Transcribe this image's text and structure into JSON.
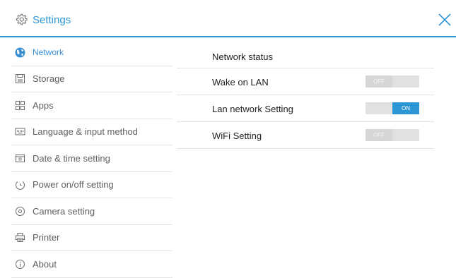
{
  "header": {
    "title": "Settings",
    "accent_color": "#2d97d5",
    "settings_icon": "gear-icon",
    "close_icon": "close-icon"
  },
  "sidebar": {
    "items": [
      {
        "label": "Network",
        "icon": "globe-icon",
        "active": true
      },
      {
        "label": "Storage",
        "icon": "storage-icon",
        "active": false
      },
      {
        "label": "Apps",
        "icon": "apps-grid-icon",
        "active": false
      },
      {
        "label": "Language & input method",
        "icon": "keyboard-icon",
        "active": false
      },
      {
        "label": "Date & time setting",
        "icon": "calendar-icon",
        "active": false
      },
      {
        "label": "Power on/off setting",
        "icon": "power-icon",
        "active": false
      },
      {
        "label": "Camera setting",
        "icon": "camera-icon",
        "active": false
      },
      {
        "label": "Printer",
        "icon": "printer-icon",
        "active": false
      },
      {
        "label": "About",
        "icon": "info-icon",
        "active": false
      }
    ]
  },
  "main": {
    "rows": [
      {
        "label": "Network status"
      },
      {
        "label": "Wake on LAN",
        "toggle": "OFF"
      },
      {
        "label": "Lan network Setting",
        "toggle": "ON"
      },
      {
        "label": "WiFi Setting",
        "toggle": "OFF"
      }
    ]
  }
}
